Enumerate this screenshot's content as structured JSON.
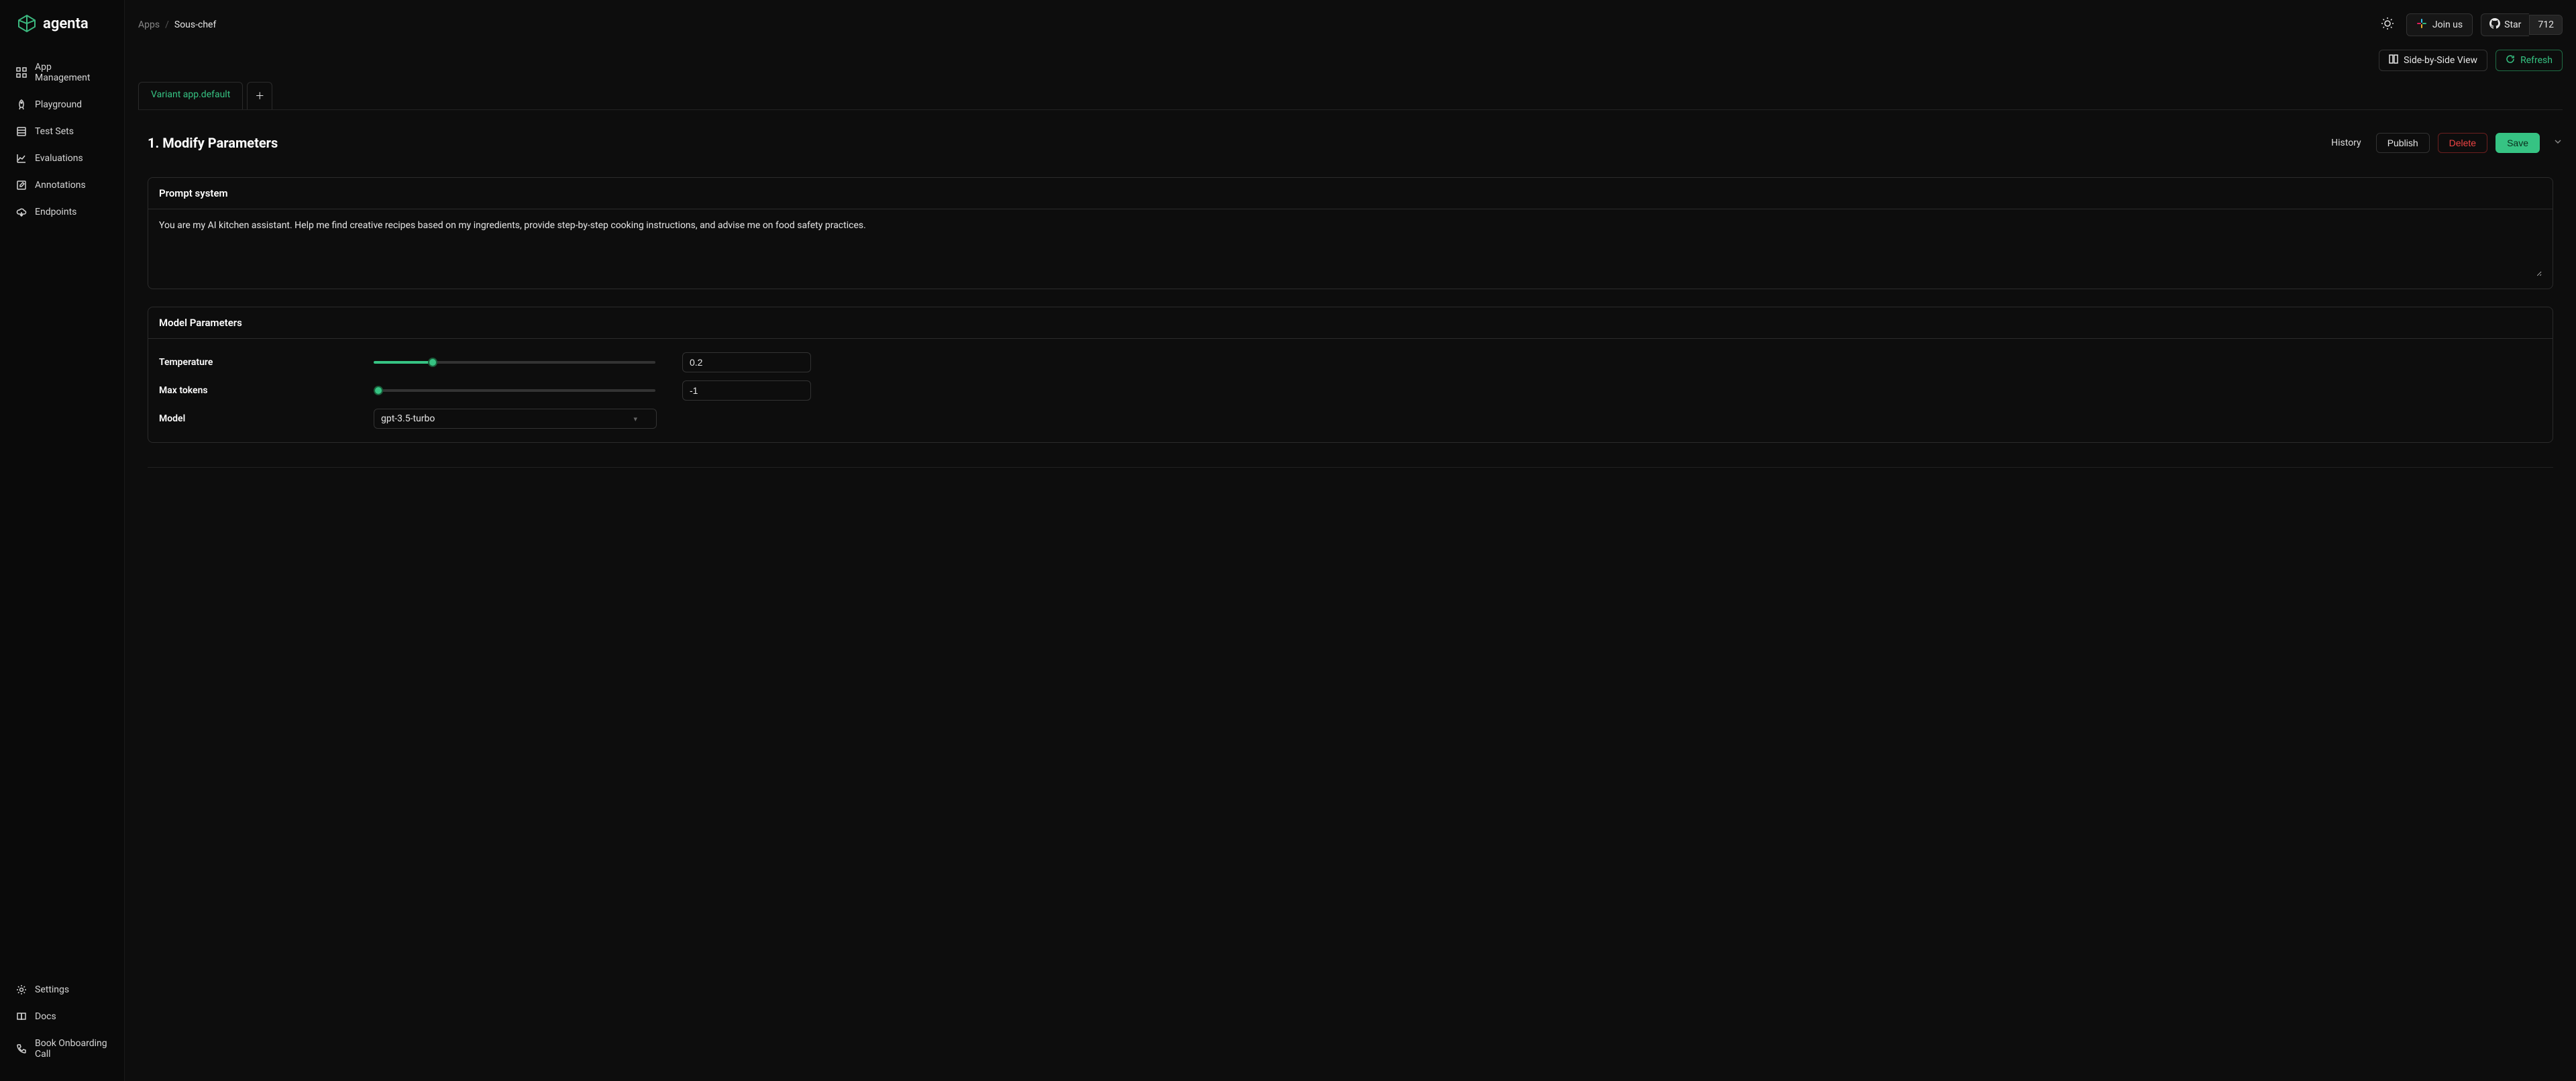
{
  "brand": "agenta",
  "sidebar": {
    "items": [
      {
        "label": "App Management",
        "icon": "grid-icon"
      },
      {
        "label": "Playground",
        "icon": "rocket-icon"
      },
      {
        "label": "Test Sets",
        "icon": "database-icon"
      },
      {
        "label": "Evaluations",
        "icon": "chart-icon"
      },
      {
        "label": "Annotations",
        "icon": "edit-icon"
      },
      {
        "label": "Endpoints",
        "icon": "cloud-icon"
      }
    ],
    "bottom": [
      {
        "label": "Settings",
        "icon": "gear-icon"
      },
      {
        "label": "Docs",
        "icon": "book-icon"
      },
      {
        "label": "Book Onboarding Call",
        "icon": "phone-icon"
      }
    ]
  },
  "breadcrumb": {
    "root": "Apps",
    "current": "Sous-chef"
  },
  "topbar": {
    "join_label": "Join us",
    "star_label": "Star",
    "star_count": "712"
  },
  "toolbar": {
    "side_by_side": "Side-by-Side View",
    "refresh": "Refresh"
  },
  "tabs": {
    "variant_label": "Variant app.default"
  },
  "section": {
    "title": "1. Modify Parameters",
    "history": "History",
    "publish": "Publish",
    "delete": "Delete",
    "save": "Save"
  },
  "prompt": {
    "heading": "Prompt system",
    "value": "You are my AI kitchen assistant. Help me find creative recipes based on my ingredients, provide step-by-step cooking instructions, and advise me on food safety practices."
  },
  "model_params": {
    "heading": "Model Parameters",
    "temperature_label": "Temperature",
    "temperature_value": "0.2",
    "max_tokens_label": "Max tokens",
    "max_tokens_value": "-1",
    "model_label": "Model",
    "model_value": "gpt-3.5-turbo"
  }
}
